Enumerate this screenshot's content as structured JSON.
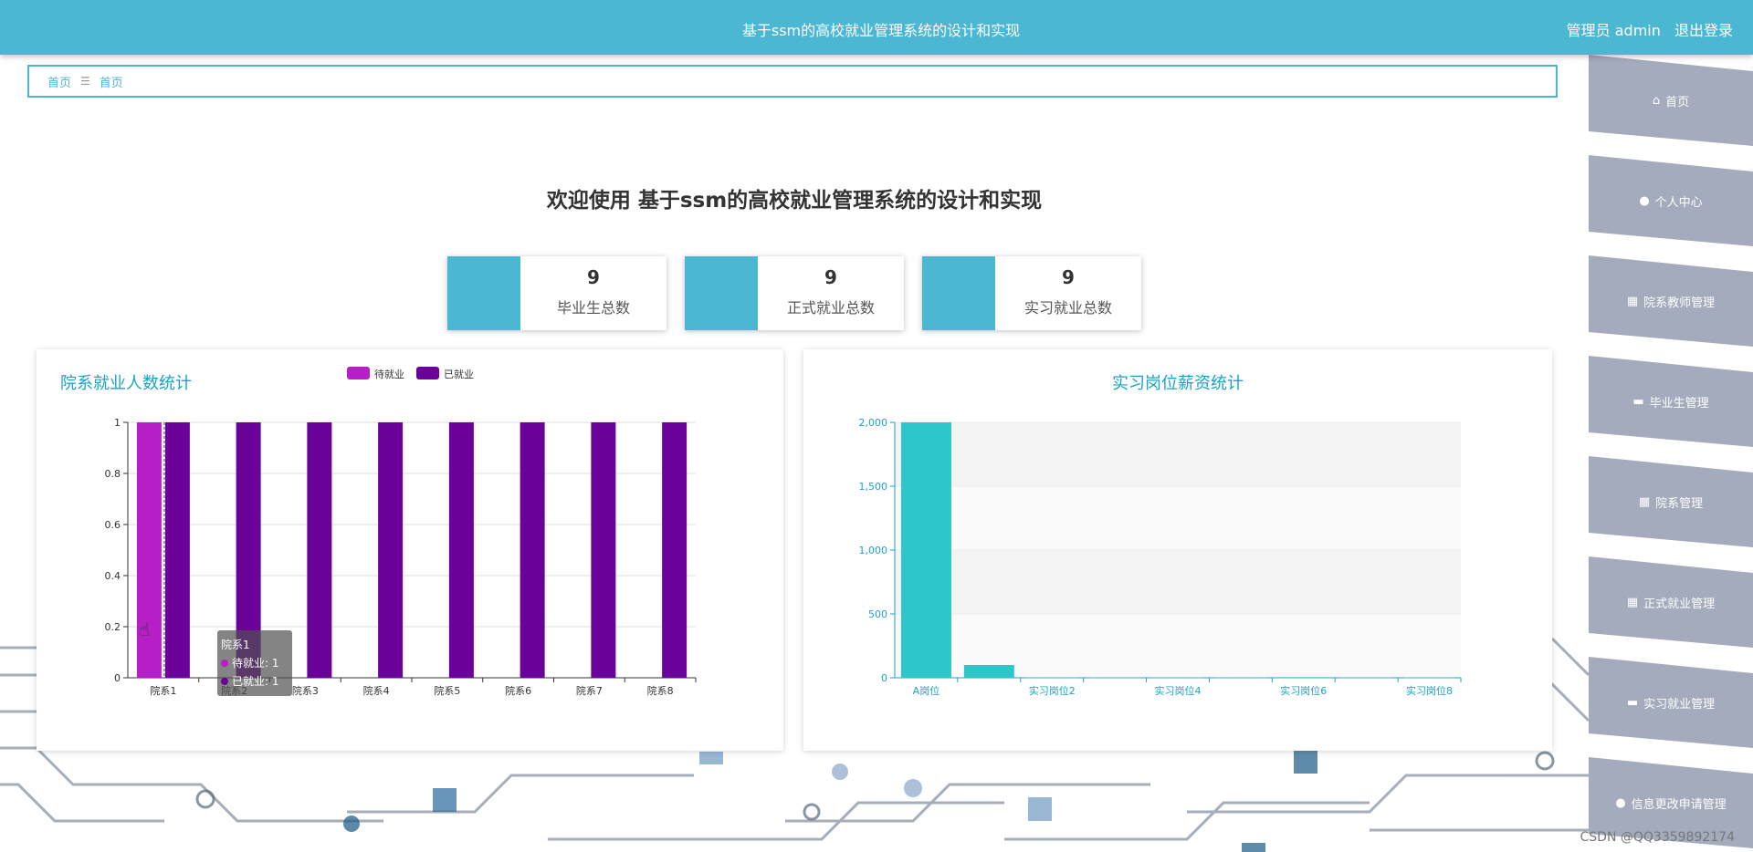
{
  "header": {
    "title": "基于ssm的高校就业管理系统的设计和实现",
    "user_role": "管理员 admin",
    "logout_label": "退出登录"
  },
  "breadcrumb": {
    "items": [
      "首页",
      "首页"
    ]
  },
  "sidebar": {
    "items": [
      {
        "label": "首页",
        "icon": "home-icon"
      },
      {
        "label": "个人中心",
        "icon": "user-icon"
      },
      {
        "label": "院系教师管理",
        "icon": "grid-icon"
      },
      {
        "label": "毕业生管理",
        "icon": "chat-icon"
      },
      {
        "label": "院系管理",
        "icon": "grid-icon"
      },
      {
        "label": "正式就业管理",
        "icon": "grid-icon"
      },
      {
        "label": "实习就业管理",
        "icon": "chat-icon"
      },
      {
        "label": "信息更改申请管理",
        "icon": "user-icon"
      }
    ]
  },
  "welcome": "欢迎使用 基于ssm的高校就业管理系统的设计和实现",
  "stats": [
    {
      "value": "9",
      "label": "毕业生总数"
    },
    {
      "value": "9",
      "label": "正式就业总数"
    },
    {
      "value": "9",
      "label": "实习就业总数"
    }
  ],
  "colors": {
    "primary": "#4bb7d3",
    "pending": "#b61fc8",
    "employed": "#6a0199",
    "salary_bar": "#2ec7c9",
    "sidebar": "#a3abbc"
  },
  "chart_data": [
    {
      "type": "bar",
      "title": "院系就业人数统计",
      "categories": [
        "院系1",
        "院系2",
        "院系3",
        "院系4",
        "院系5",
        "院系6",
        "院系7",
        "院系8"
      ],
      "series": [
        {
          "name": "待就业",
          "values": [
            1,
            0,
            0,
            0,
            0,
            0,
            0,
            0
          ]
        },
        {
          "name": "已就业",
          "values": [
            1,
            1,
            1,
            1,
            1,
            1,
            1,
            1
          ]
        }
      ],
      "yticks": [
        "0",
        "0.2",
        "0.4",
        "0.6",
        "0.8",
        "1"
      ],
      "ylim": [
        0,
        1
      ],
      "legend": "top-center",
      "tooltip": {
        "category": "院系1",
        "lines": [
          "待就业: 1",
          "已就业: 1"
        ]
      }
    },
    {
      "type": "bar",
      "title": "实习岗位薪资统计",
      "categories": [
        "A岗位",
        "",
        "实习岗位2",
        "",
        "实习岗位4",
        "",
        "实习岗位6",
        "",
        "实习岗位8"
      ],
      "values": [
        2000,
        100,
        3,
        3,
        3,
        3,
        5,
        3,
        3
      ],
      "yticks": [
        "0",
        "500",
        "1,000",
        "1,500",
        "2,000"
      ],
      "ylim": [
        0,
        2000
      ]
    }
  ],
  "watermark": "CSDN @QQ3359892174"
}
